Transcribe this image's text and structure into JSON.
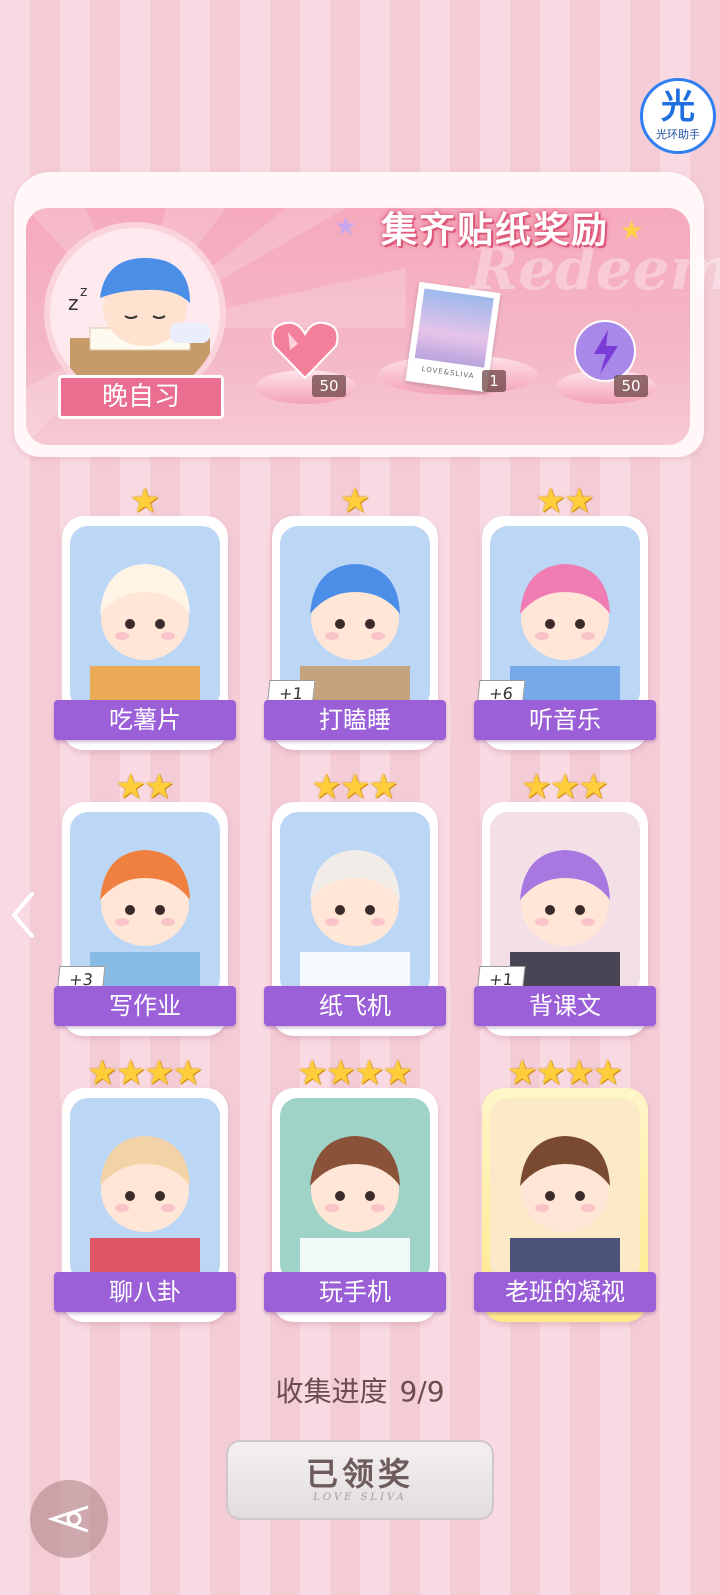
{
  "helper_badge": {
    "glyph": "光",
    "label": "光环助手"
  },
  "reward_banner": {
    "title": "集齐贴纸奖励",
    "watermark": "Redeem",
    "avatar_tag": "晚自习",
    "rewards": [
      {
        "icon": "heart-gem-icon",
        "count": "50"
      },
      {
        "icon": "photo-card-icon",
        "count": "1",
        "caption": "LOVE&SLIVA"
      },
      {
        "icon": "purple-orb-icon",
        "count": "50"
      }
    ]
  },
  "stickers": [
    {
      "label": "吃薯片",
      "stars": 1,
      "plus": "",
      "art": "cat-eating-chips"
    },
    {
      "label": "打瞌睡",
      "stars": 1,
      "plus": "+1",
      "art": "boy-sleeping"
    },
    {
      "label": "听音乐",
      "stars": 2,
      "plus": "+6",
      "art": "girl-headphones"
    },
    {
      "label": "写作业",
      "stars": 2,
      "plus": "+3",
      "art": "boy-homework"
    },
    {
      "label": "纸飞机",
      "stars": 3,
      "plus": "",
      "art": "cat-paper-plane"
    },
    {
      "label": "背课文",
      "stars": 3,
      "plus": "+1",
      "art": "girl-reciting"
    },
    {
      "label": "聊八卦",
      "stars": 4,
      "plus": "",
      "art": "dog-watermelon"
    },
    {
      "label": "玩手机",
      "stars": 4,
      "plus": "",
      "art": "girl-phone"
    },
    {
      "label": "老班的凝视",
      "stars": 4,
      "plus": "",
      "art": "teacher-gaze"
    }
  ],
  "progress": {
    "label": "收集进度",
    "value": "9/9"
  },
  "claimed_button": {
    "label": "已领奖",
    "sub": "LOVE SLIVA"
  },
  "colors": {
    "label_purple": "#9b5fd8",
    "banner_pink": "#f6a9bd",
    "star_gold": "#ffce3a"
  }
}
